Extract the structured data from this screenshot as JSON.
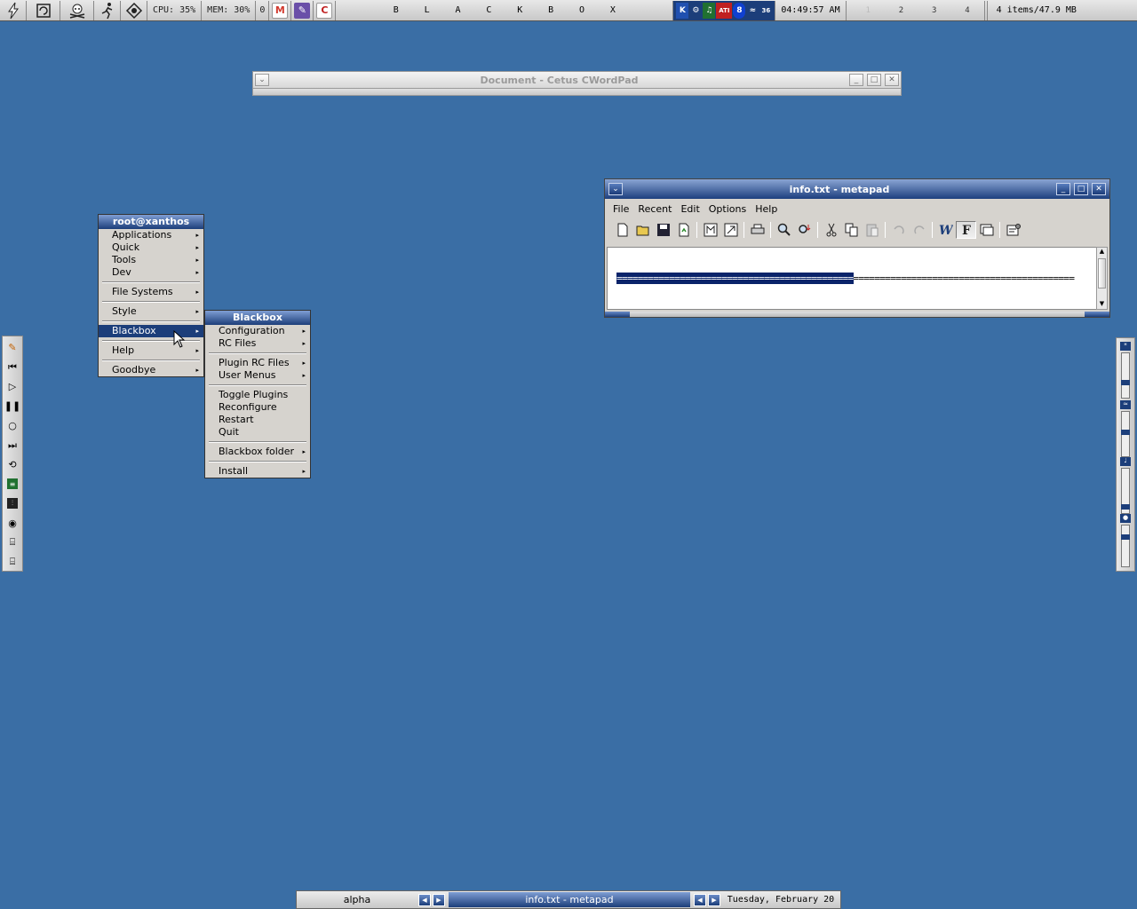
{
  "topbar": {
    "cpu": "CPU: 35%",
    "mem": "MEM: 30%",
    "counter": "0",
    "blackbox_letters": [
      "B",
      "L",
      "A",
      "C",
      "K",
      "B",
      "O",
      "X"
    ],
    "clock": "04:49:57 AM",
    "pager": [
      "1",
      "2",
      "3",
      "4"
    ],
    "trash_info": "4 items/47.9 MB",
    "app_icons": [
      {
        "name": "gmail-icon",
        "glyph": "M",
        "color": "#d23b2f"
      },
      {
        "name": "notes-icon",
        "glyph": "✎",
        "color": "#6a4fa8"
      },
      {
        "name": "calendar-icon",
        "glyph": "C",
        "color": "#c02020"
      }
    ],
    "tray_icons": [
      "K",
      "⚙",
      "♫",
      "ATI",
      "8",
      "≈",
      "36"
    ]
  },
  "wordpad": {
    "title": "Document - Cetus CWordPad"
  },
  "metapad": {
    "title": "info.txt - metapad",
    "menu": [
      "File",
      "Recent",
      "Edit",
      "Options",
      "Help"
    ],
    "text_selected": "=============================================",
    "text_rest": "=========================================="
  },
  "rootmenu": {
    "title": "root@xanthos",
    "groups": [
      [
        "Applications",
        "Quick",
        "Tools",
        "Dev"
      ],
      [
        "File Systems"
      ],
      [
        "Style"
      ],
      [
        "Blackbox"
      ],
      [
        "Help"
      ],
      [
        "Goodbye"
      ]
    ],
    "highlighted": "Blackbox"
  },
  "bbmenu": {
    "title": "Blackbox",
    "groups": [
      [
        {
          "label": "Configuration",
          "sub": true
        },
        {
          "label": "RC Files",
          "sub": true
        }
      ],
      [
        {
          "label": "Plugin RC Files",
          "sub": true
        },
        {
          "label": "User Menus",
          "sub": true
        }
      ],
      [
        {
          "label": "Toggle Plugins",
          "sub": false
        },
        {
          "label": "Reconfigure",
          "sub": false
        },
        {
          "label": "Restart",
          "sub": false
        },
        {
          "label": "Quit",
          "sub": false
        }
      ],
      [
        {
          "label": "Blackbox folder",
          "sub": true
        }
      ],
      [
        {
          "label": "Install",
          "sub": true
        }
      ]
    ]
  },
  "taskbar": {
    "workspace": "alpha",
    "task": "info.txt - metapad",
    "date": "Tuesday, February 20"
  },
  "colors": {
    "desktop": "#3a6ea5",
    "accent": "#1c3e7a",
    "selection": "#0a246a"
  }
}
